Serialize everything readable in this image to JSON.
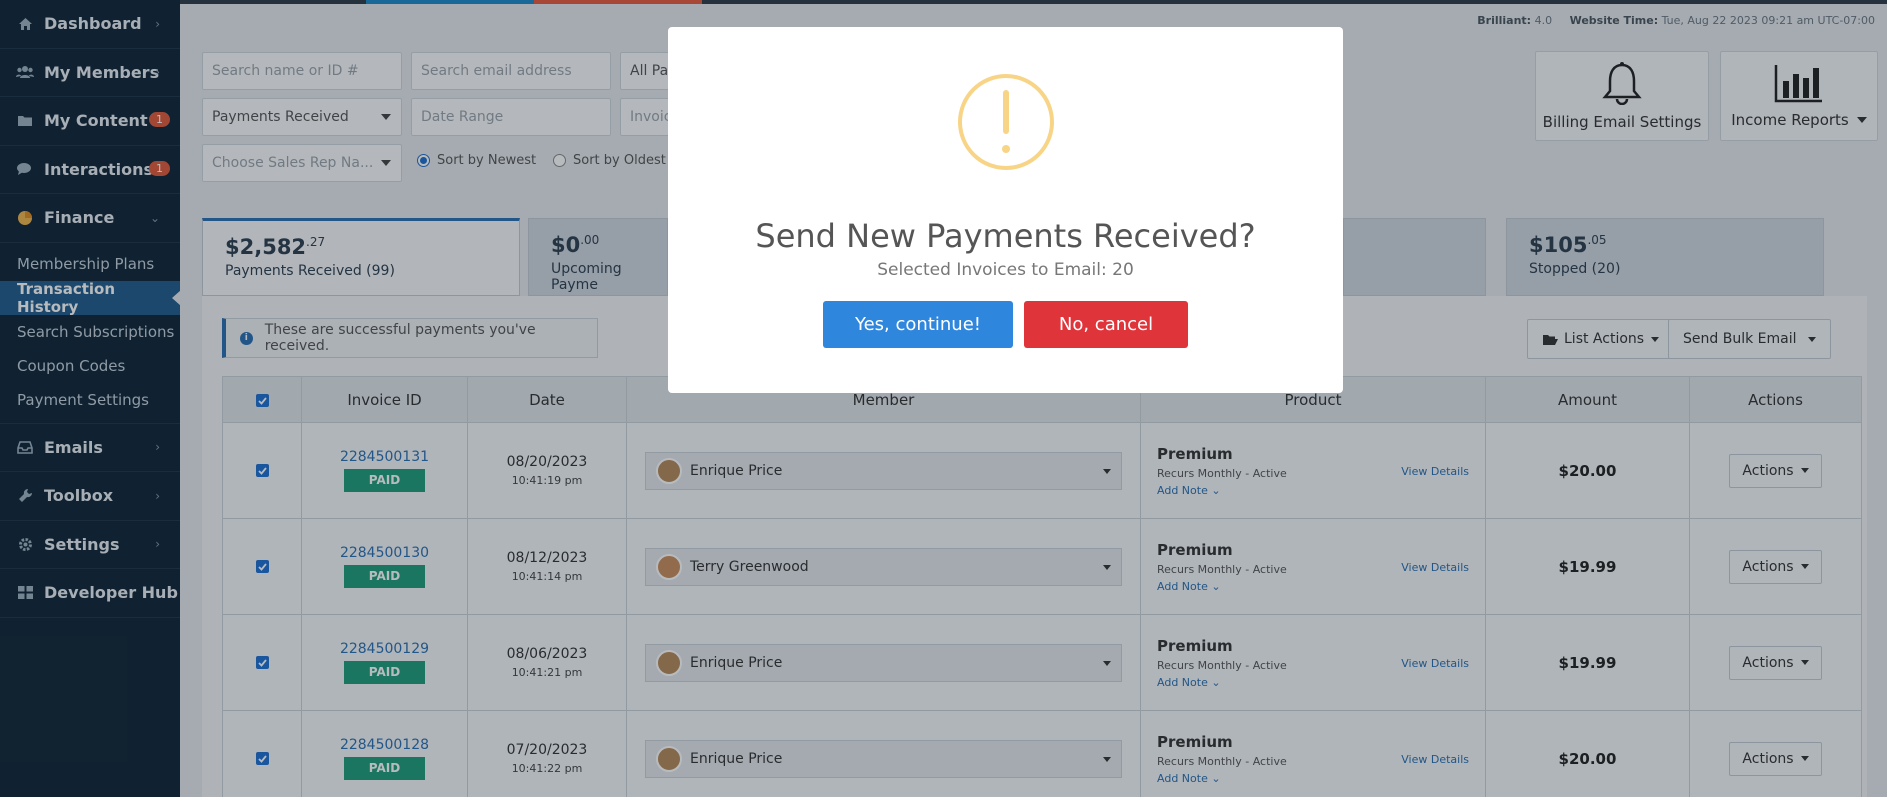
{
  "sidebar": {
    "items": [
      {
        "label": "Dashboard",
        "icon": "home-icon"
      },
      {
        "label": "My Members",
        "icon": "users-icon"
      },
      {
        "label": "My Content",
        "icon": "folder-icon",
        "badge": "1"
      },
      {
        "label": "Interactions",
        "icon": "comments-icon",
        "badge": "1"
      },
      {
        "label": "Finance",
        "icon": "pie-chart-icon"
      }
    ],
    "finance_sub": [
      "Membership Plans",
      "Transaction History",
      "Search Subscriptions",
      "Coupon Codes",
      "Payment Settings"
    ],
    "bottom_items": [
      {
        "label": "Emails",
        "icon": "inbox-icon"
      },
      {
        "label": "Toolbox",
        "icon": "wrench-icon"
      },
      {
        "label": "Settings",
        "icon": "gear-icon"
      },
      {
        "label": "Developer Hub",
        "icon": "grid-icon"
      }
    ]
  },
  "site_info": {
    "brand_label": "Brilliant:",
    "brand_version": "4.0",
    "time_label": "Website Time:",
    "time_value": "Tue, Aug 22 2023 09:21 am UTC-07:00"
  },
  "filters": {
    "search_name": "Search name or ID #",
    "search_email": "Search email address",
    "all_plans": "All Pa",
    "payments_received": "Payments Received",
    "date_range": "Date Range",
    "invoice": "Invoic",
    "sales_rep": "Choose Sales Rep Na...",
    "sort_newest": "Sort by Newest",
    "sort_oldest": "Sort by Oldest"
  },
  "tools": {
    "billing_email": "Billing Email Settings",
    "income_reports": "Income Reports"
  },
  "stat_tabs": [
    {
      "amount": "$2,582",
      "cents": ".27",
      "label": "Payments Received (99)"
    },
    {
      "amount": "$0",
      "cents": ".00",
      "label": "Upcoming Payme"
    },
    {
      "amount": "$105",
      "cents": ".05",
      "label": "Stopped (20)"
    }
  ],
  "panel": {
    "info": "These are successful payments you've received.",
    "list_actions": "List Actions",
    "send_bulk": "Send Bulk Email"
  },
  "table": {
    "headers": [
      "Invoice ID",
      "Date",
      "Member",
      "Product",
      "Amount",
      "Actions"
    ],
    "rows": [
      {
        "invoice": "2284500131",
        "status": "PAID",
        "date": "08/20/2023",
        "time": "10:41:19 pm",
        "member": "Enrique Price",
        "product": "Premium",
        "recurs": "Recurs Monthly - Active",
        "note": "Add Note",
        "view": "View Details",
        "amount": "$20.00",
        "action": "Actions"
      },
      {
        "invoice": "2284500130",
        "status": "PAID",
        "date": "08/12/2023",
        "time": "10:41:14 pm",
        "member": "Terry Greenwood",
        "product": "Premium",
        "recurs": "Recurs Monthly - Active",
        "note": "Add Note",
        "view": "View Details",
        "amount": "$19.99",
        "action": "Actions"
      },
      {
        "invoice": "2284500129",
        "status": "PAID",
        "date": "08/06/2023",
        "time": "10:41:21 pm",
        "member": "Enrique Price",
        "product": "Premium",
        "recurs": "Recurs Monthly - Active",
        "note": "Add Note",
        "view": "View Details",
        "amount": "$19.99",
        "action": "Actions"
      },
      {
        "invoice": "2284500128",
        "status": "PAID",
        "date": "07/20/2023",
        "time": "10:41:22 pm",
        "member": "Enrique Price",
        "product": "Premium",
        "recurs": "Recurs Monthly - Active",
        "note": "Add Note",
        "view": "View Details",
        "amount": "$20.00",
        "action": "Actions"
      }
    ]
  },
  "modal": {
    "title": "Send New Payments Received?",
    "subtitle": "Selected Invoices to Email: 20",
    "confirm": "Yes, continue!",
    "cancel": "No, cancel",
    "icon": "warning-icon"
  },
  "colors": {
    "accent": "#2f86dd",
    "danger": "#e0343b",
    "paid": "#1e9c7a",
    "sidebar": "#0f2435",
    "warning": "#f8d486"
  }
}
